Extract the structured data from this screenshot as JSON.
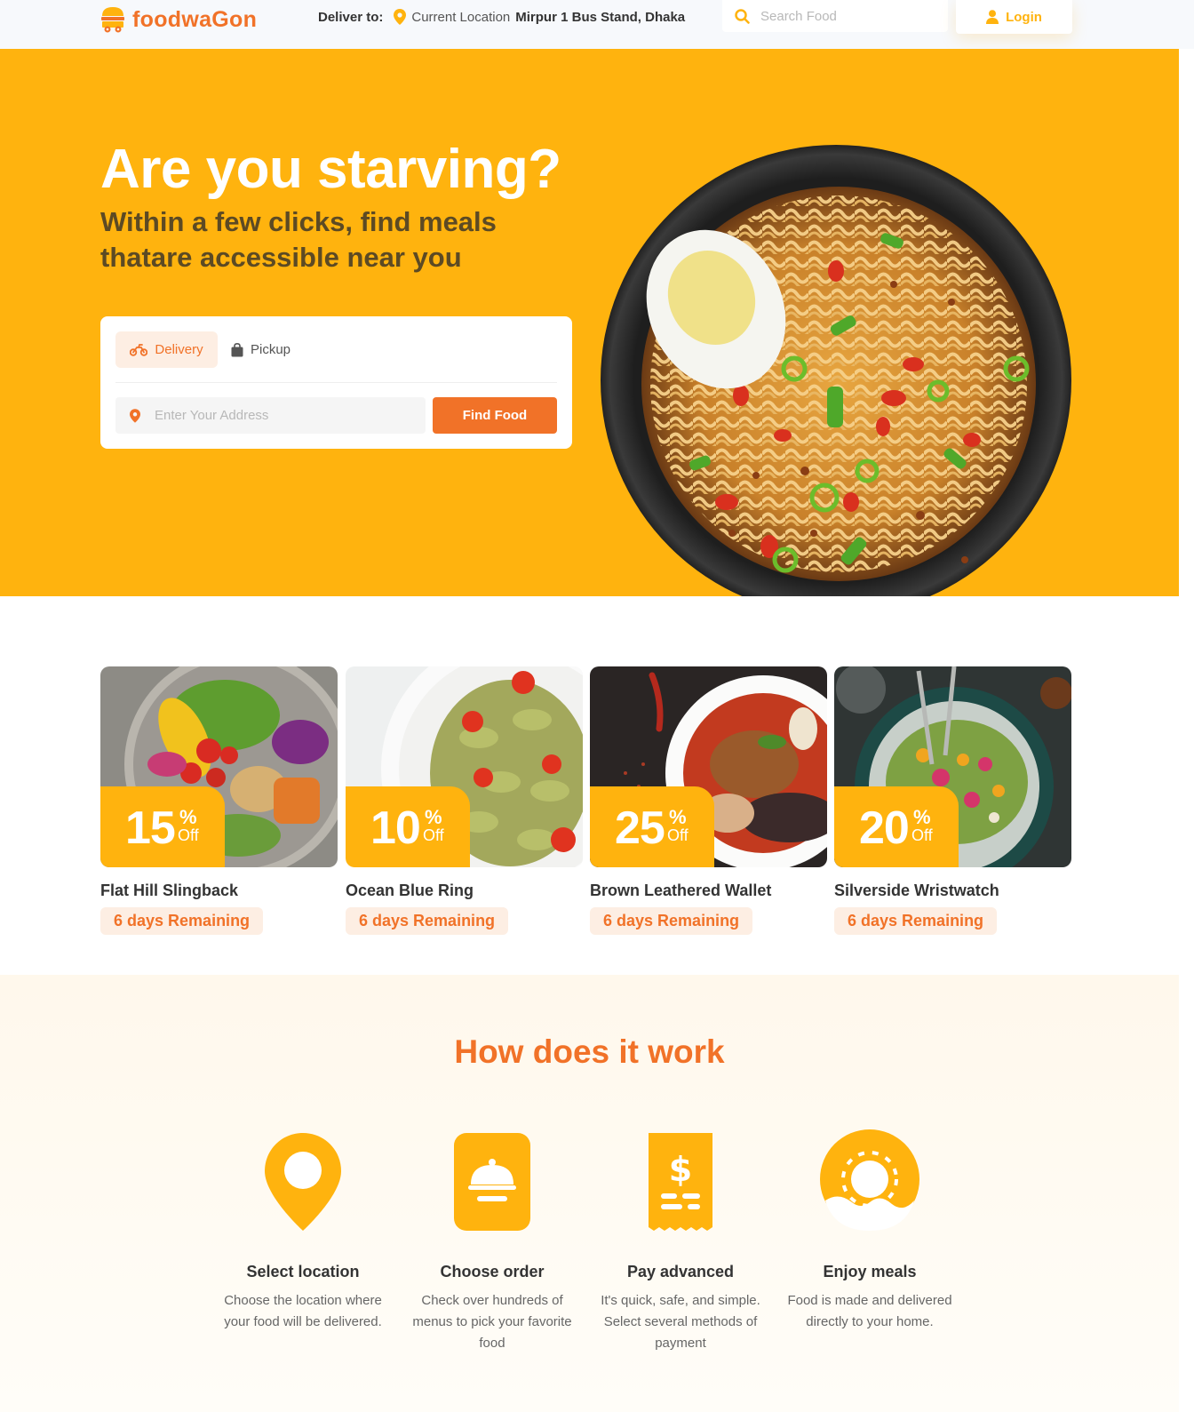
{
  "nav": {
    "brand": "foodwaGon",
    "deliver_label": "Deliver to:",
    "current_location": "Current Location",
    "address": "Mirpur 1 Bus Stand, Dhaka",
    "search_placeholder": "Search Food",
    "login_label": "Login"
  },
  "hero": {
    "title": "Are you starving?",
    "subtitle": "Within a few clicks, find meals thatare accessible near you",
    "tabs": [
      {
        "label": "Delivery",
        "icon": "motorcycle-icon",
        "active": true
      },
      {
        "label": "Pickup",
        "icon": "shopping-bag-icon",
        "active": false
      }
    ],
    "address_placeholder": "Enter Your Address",
    "find_button": "Find Food"
  },
  "deals": [
    {
      "discount": "15",
      "pct": "%",
      "off": "Off",
      "name": "Flat Hill Slingback",
      "remaining": "6 days Remaining"
    },
    {
      "discount": "10",
      "pct": "%",
      "off": "Off",
      "name": "Ocean Blue Ring",
      "remaining": "6 days Remaining"
    },
    {
      "discount": "25",
      "pct": "%",
      "off": "Off",
      "name": "Brown Leathered Wallet",
      "remaining": "6 days Remaining"
    },
    {
      "discount": "20",
      "pct": "%",
      "off": "Off",
      "name": "Silverside Wristwatch",
      "remaining": "6 days Remaining"
    }
  ],
  "how": {
    "title": "How does it work",
    "steps": [
      {
        "icon": "location-pin-icon",
        "title": "Select location",
        "desc": "Choose the location where your food will be delivered."
      },
      {
        "icon": "order-bell-icon",
        "title": "Choose order",
        "desc": "Check over hundreds of menus to pick your favorite food"
      },
      {
        "icon": "receipt-dollar-icon",
        "title": "Pay advanced",
        "desc": "It's quick, safe, and simple. Select several methods of payment"
      },
      {
        "icon": "donut-icon",
        "title": "Enjoy meals",
        "desc": "Food is made and delivered directly to your home."
      }
    ]
  },
  "colors": {
    "primary": "#ffb30e",
    "accent": "#f17228"
  }
}
